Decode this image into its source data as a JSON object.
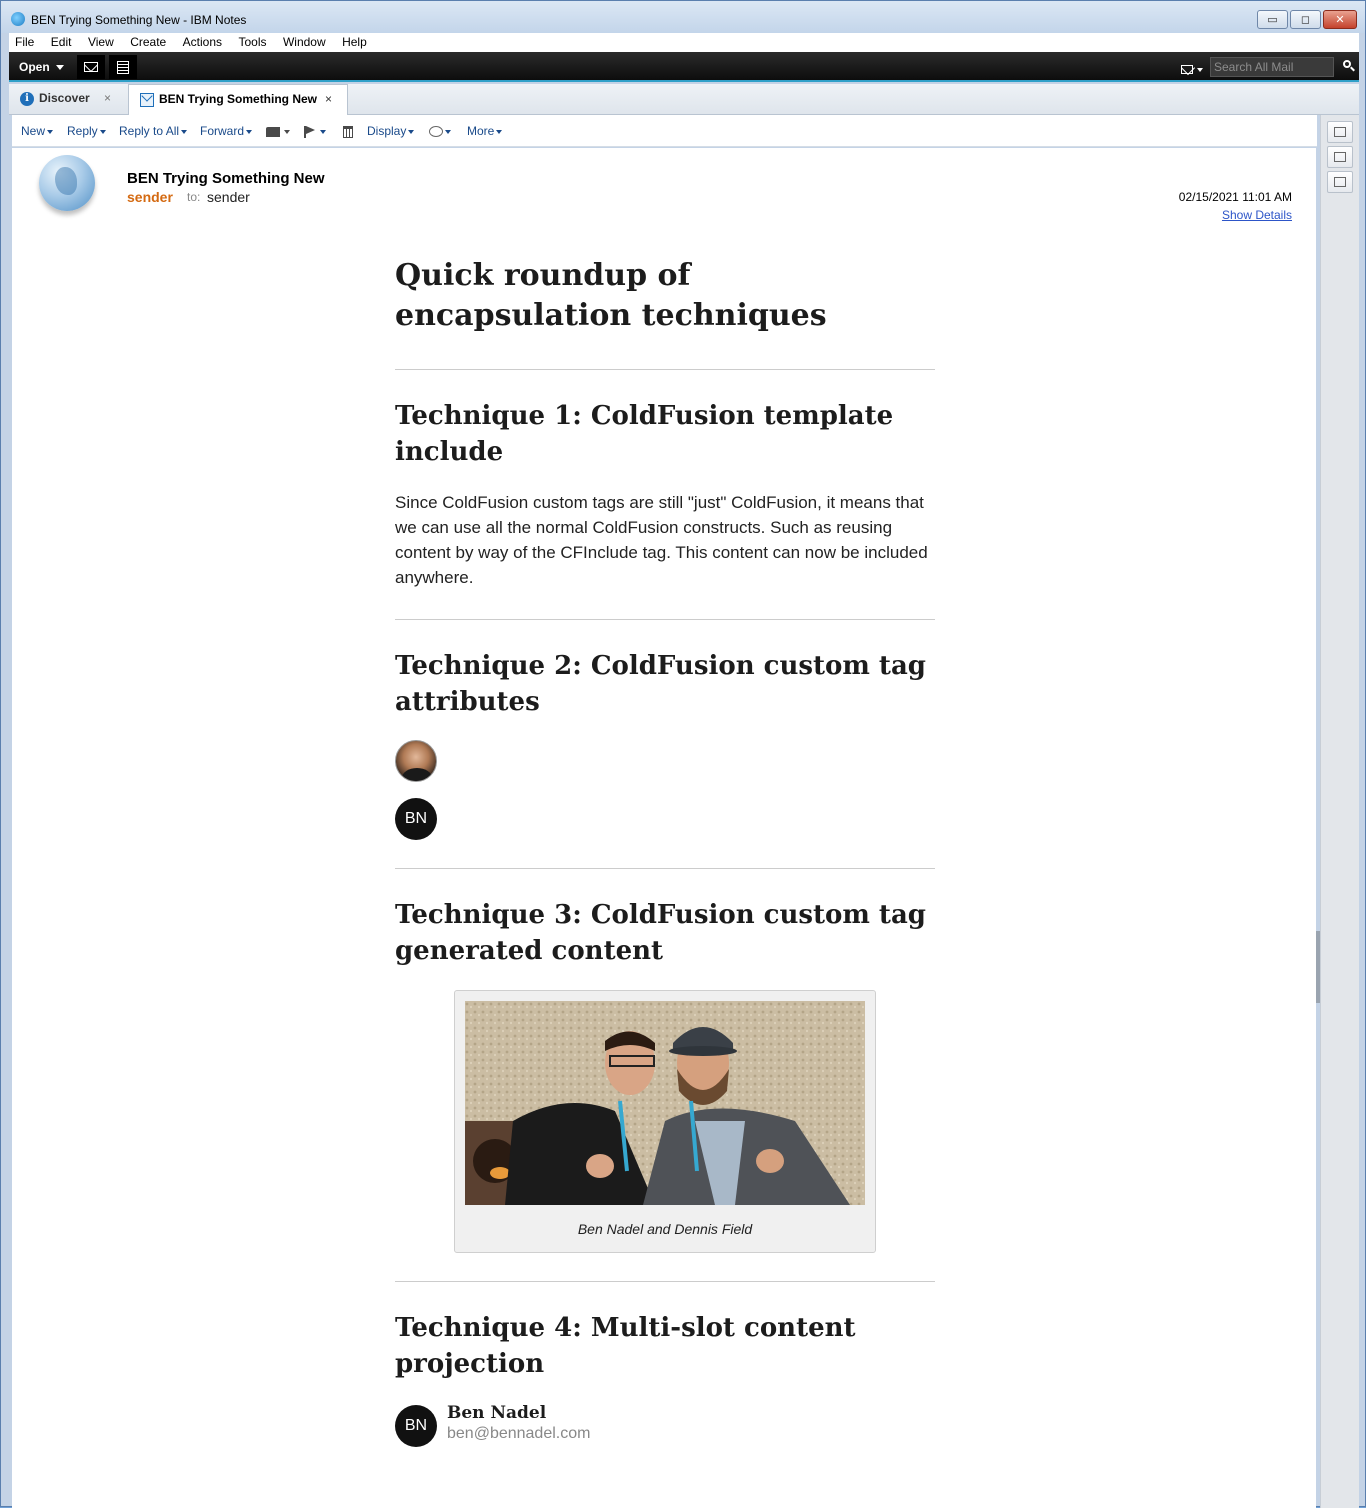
{
  "window": {
    "title": "BEN Trying Something New - IBM Notes",
    "controls": {
      "minimize": "▭",
      "maximize": "◻",
      "close": "✕"
    }
  },
  "menu": [
    "File",
    "Edit",
    "View",
    "Create",
    "Actions",
    "Tools",
    "Window",
    "Help"
  ],
  "blackbar": {
    "open_label": "Open",
    "search_placeholder": "Search All Mail"
  },
  "tabs": [
    {
      "label": "Discover",
      "icon": "info-icon",
      "close": "×"
    },
    {
      "label": "BEN Trying Something New",
      "icon": "envelope-icon",
      "close": "×"
    }
  ],
  "actions": {
    "new": "New",
    "reply": "Reply",
    "reply_all": "Reply to All",
    "forward": "Forward",
    "display": "Display",
    "more": "More"
  },
  "mail": {
    "subject": "BEN Trying Something New",
    "from": "sender",
    "to_label": "to:",
    "to": "sender",
    "date": "02/15/2021 11:01 AM",
    "show_details": "Show Details"
  },
  "article": {
    "title": "Quick roundup of encapsulation techniques",
    "sections": [
      {
        "heading": "Technique 1: ColdFusion template include",
        "body": "Since ColdFusion custom tags are still \"just\" ColdFusion, it means that we can use all the normal ColdFusion constructs. Such as reusing content by way of the CFInclude tag. This content can now be included anywhere."
      },
      {
        "heading": "Technique 2: ColdFusion custom tag attributes",
        "avatar_initials": "BN"
      },
      {
        "heading": "Technique 3: ColdFusion custom tag generated content",
        "caption": "Ben Nadel and Dennis Field"
      },
      {
        "heading": "Technique 4: Multi-slot content projection",
        "avatar_initials": "BN",
        "name": "Ben Nadel",
        "email": "ben@bennadel.com"
      }
    ]
  },
  "colors": {
    "accent": "#2fa0c8",
    "sender": "#d46a12",
    "link": "#2d55c8"
  }
}
